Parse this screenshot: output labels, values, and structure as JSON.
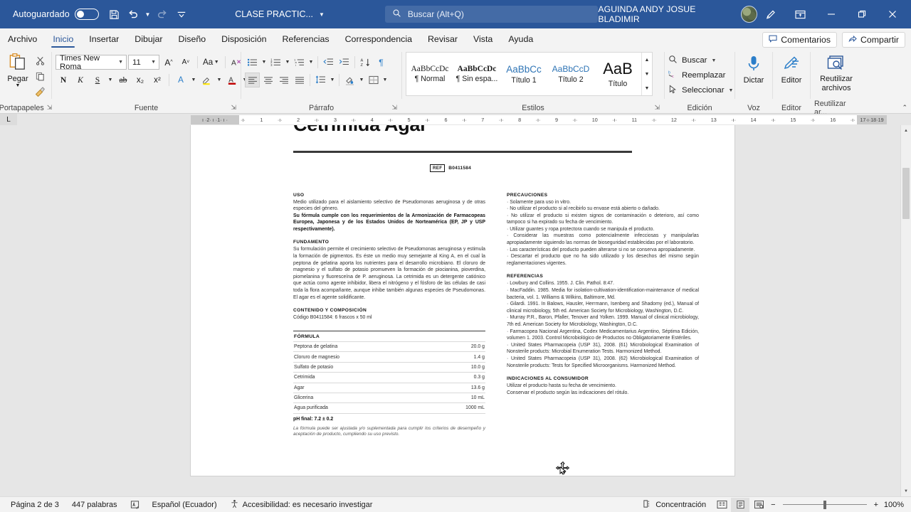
{
  "titlebar": {
    "autosave_label": "Autoguardado",
    "autosave_state": "off",
    "save_icon": "save-icon",
    "undo_icon": "undo-icon",
    "redo_icon": "redo-icon",
    "customize_icon": "customize-quick-access-icon",
    "document_title": "CLASE PRACTIC...",
    "search_placeholder": "Buscar (Alt+Q)",
    "search_icon": "search-icon",
    "account_name": "AGUINDA ANDY JOSUE BLADIMIR",
    "avatar": "user-avatar",
    "ribbon_display_icon": "ribbon-display-options-icon",
    "pen_icon": "pen-icon",
    "minimize": "–",
    "restore": "restore-icon",
    "close": "✕"
  },
  "tabs": [
    {
      "label": "Archivo",
      "active": false
    },
    {
      "label": "Inicio",
      "active": true
    },
    {
      "label": "Insertar",
      "active": false
    },
    {
      "label": "Dibujar",
      "active": false
    },
    {
      "label": "Diseño",
      "active": false
    },
    {
      "label": "Disposición",
      "active": false
    },
    {
      "label": "Referencias",
      "active": false
    },
    {
      "label": "Correspondencia",
      "active": false
    },
    {
      "label": "Revisar",
      "active": false
    },
    {
      "label": "Vista",
      "active": false
    },
    {
      "label": "Ayuda",
      "active": false
    }
  ],
  "tab_actions": {
    "comments_label": "Comentarios",
    "share_label": "Compartir"
  },
  "ribbon": {
    "clipboard": {
      "group_name": "Portapapeles",
      "paste_label": "Pegar",
      "cut_icon": "cut-icon",
      "copy_icon": "copy-icon",
      "format_painter_icon": "format-painter-icon"
    },
    "font": {
      "group_name": "Fuente",
      "font_family": "Times New Roma",
      "font_size": "11",
      "grow_font": "A",
      "shrink_font": "A",
      "change_case": "Aa",
      "clear_format_icon": "clear-formatting-icon",
      "bold": "N",
      "italic": "K",
      "underline": "S",
      "strikethrough": "ab",
      "subscript": "x₂",
      "superscript": "x²",
      "text_effects": "A",
      "highlight": "A",
      "font_color": "A"
    },
    "paragraph": {
      "group_name": "Párrafo",
      "bullets_icon": "bullet-list-icon",
      "numbering_icon": "numbered-list-icon",
      "multilevel_icon": "multilevel-list-icon",
      "decrease_indent_icon": "decrease-indent-icon",
      "increase_indent_icon": "increase-indent-icon",
      "sort_icon": "sort-icon",
      "marks_icon": "paragraph-marks-icon",
      "align_left_icon": "align-left-icon",
      "align_center_icon": "align-center-icon",
      "align_right_icon": "align-right-icon",
      "justify_icon": "justify-icon",
      "line_spacing_icon": "line-spacing-icon",
      "shading_icon": "shading-icon",
      "borders_icon": "borders-icon"
    },
    "styles": {
      "group_name": "Estilos",
      "items": [
        {
          "preview": "AaBbCcDc",
          "name": "¶ Normal"
        },
        {
          "preview": "AaBbCcDc",
          "name": "¶ Sin espa..."
        },
        {
          "preview": "AaBbCc",
          "name": "Título 1"
        },
        {
          "preview": "AaBbCcD",
          "name": "Título 2"
        },
        {
          "preview": "AaB",
          "name": "Título"
        }
      ]
    },
    "editing": {
      "group_name": "Edición",
      "find_label": "Buscar",
      "replace_label": "Reemplazar",
      "select_label": "Seleccionar"
    },
    "voice": {
      "group_name": "Voz",
      "dictate_label": "Dictar"
    },
    "editor": {
      "group_name": "Editor",
      "editor_label": "Editor"
    },
    "reuse": {
      "group_name": "Reutilizar ar...",
      "reuse_label_1": "Reutilizar",
      "reuse_label_2": "archivos"
    }
  },
  "ruler": {
    "tab_stop_selector": "L",
    "left_ticks": [
      "2",
      "1"
    ],
    "ticks": [
      "1",
      "2",
      "3",
      "4",
      "5",
      "6",
      "7",
      "8",
      "9",
      "10",
      "11",
      "12",
      "13",
      "14",
      "15",
      "16",
      "17"
    ],
    "right_ticks": [
      "18",
      "19"
    ]
  },
  "document": {
    "title": "Cetrimida Agar",
    "ref_tag": "REF",
    "ref_value": "B0411584",
    "left_column": {
      "uso_heading": "USO",
      "uso_text": "Medio utilizado para el aislamiento selectivo de Pseudomonas aeruginosa y de otras especies del género.",
      "uso_bold": "Su fórmula cumple con los requerimientos de la Armonización de Farmacopeas Europea, Japonesa y de los Estados Unidos de Norteamérica (EP, JP y USP respectivamente).",
      "fundamento_heading": "FUNDAMENTO",
      "fundamento_text": "Su formulación permite el crecimiento selectivo de Pseudomonas aeruginosa y estimula la formación de pigmentos. Es éste un medio muy semejante al King A, en el cual la peptona de gelatina aporta los nutrientes para el desarrollo microbiano. El cloruro de magnesio y el sulfato de potasio promueven la formación de piocianina, pioverdina, piomelanina y fluoresceína de P. aeruginosa. La cetrimida es un detergente catiónico que actúa como agente inhibidor, libera el nitrógeno y el fósforo de las células de casi toda la flora acompañante, aunque inhibe también algunas especies de Pseudomonas. El agar es el agente solidificante.",
      "contenido_heading": "CONTENIDO Y COMPOSICIÓN",
      "contenido_text": "Código B0411584: 6 frascos x 50 ml",
      "formula_heading": "FÓRMULA",
      "formula_rows": [
        {
          "ingredient": "Peptona de gelatina",
          "amount": "20.0 g"
        },
        {
          "ingredient": "Cloruro de magnesio",
          "amount": "1.4 g"
        },
        {
          "ingredient": "Sulfato de potasio",
          "amount": "10.0 g"
        },
        {
          "ingredient": "Cetrimida",
          "amount": "0.3 g"
        },
        {
          "ingredient": "Agar",
          "amount": "13.6 g"
        },
        {
          "ingredient": "Glicerina",
          "amount": "10 mL"
        },
        {
          "ingredient": "Agua purificada",
          "amount": "1000 mL"
        }
      ],
      "ph_final": "pH final: 7.2 ± 0.2",
      "formula_note": "La fórmula puede ser ajustada y/o suplementada para cumplir los criterios de desempeño y aceptación de producto, cumpliendo su uso previsto."
    },
    "right_column": {
      "precauciones_heading": "PRECAUCIONES",
      "precauciones_items": [
        "· Solamente para uso in vitro.",
        "· No utilizar el producto si al recibirlo su envase está abierto o dañado.",
        "· No utilizar el producto si existen signos de contaminación o deterioro, así como tampoco si ha expirado su fecha de vencimiento.",
        "· Utilizar guantes y ropa protectora cuando se manipula el producto.",
        "· Considerar las muestras como potencialmente infecciosas y manipularlas apropiadamente siguiendo las normas de bioseguridad establecidas por el laboratorio.",
        "· Las características del producto pueden alterarse si no se conserva apropiadamente.",
        "· Descartar el producto que no ha sido utilizado y los desechos del mismo según reglamentaciones vigentes."
      ],
      "referencias_heading": "REFERENCIAS",
      "referencias_items": [
        "· Lowbury and Collins. 1955. J. Clin. Pathol. 8:47.",
        "· MacFaddin. 1985. Media for isolation-cultivation-identification-maintenance of medical bacteria, vol. 1. Williams & Wilkins, Baltimore, Md.",
        "· Gilardi. 1991. In Balows, Hausler, Herrmann, Isenberg and Shadomy (ed.), Manual of clinical microbiology, 5th ed. American Society for Microbiology, Washington, D.C.",
        "· Murray P.R., Baron, Pfaller, Tenover and Yolken. 1999. Manual of clinical microbiology, 7th ed. American Society for Microbiology, Washington, D.C.",
        "· Farmacopea Nacional Argentina, Codex Medicamentarius Argentino, Séptima Edición, volumen 1. 2003. Control Microbiológico de Productos no Obligatoriamente Estériles.",
        "· United States Pharmacopeia (USP 31), 2008. (61) Microbiological Examination of Nonsterile products: Microbial Enumeration Tests. Harmonized Method.",
        "· United States Pharmacopeia (USP 31), 2008. (62) Microbiological Examination of Nonsterile products: Tests for Specified Microorganisms. Harmonized Method."
      ],
      "indicaciones_heading": "INDICACIONES AL CONSUMIDOR",
      "indicaciones_items": [
        "Utilizar el producto hasta su fecha de vencimiento.",
        "Conservar el producto según las indicaciones del rótulo."
      ]
    }
  },
  "status": {
    "page_info": "Página 2 de 3",
    "word_count": "447 palabras",
    "proofing_icon": "proofing-icon",
    "language": "Español (Ecuador)",
    "accessibility_icon": "accessibility-icon",
    "accessibility": "Accesibilidad: es necesario investigar",
    "focus_icon": "focus-icon",
    "focus_label": "Concentración",
    "view_read_icon": "read-mode-icon",
    "view_print_icon": "print-layout-icon",
    "view_web_icon": "web-layout-icon",
    "zoom_out": "−",
    "zoom_in": "+",
    "zoom_level": "100%"
  },
  "colors": {
    "word_blue": "#2b579a",
    "accent_heading": "#2e74b5",
    "ribbon_bg": "#f3f3f3",
    "canvas_bg": "#e6e6e6"
  }
}
